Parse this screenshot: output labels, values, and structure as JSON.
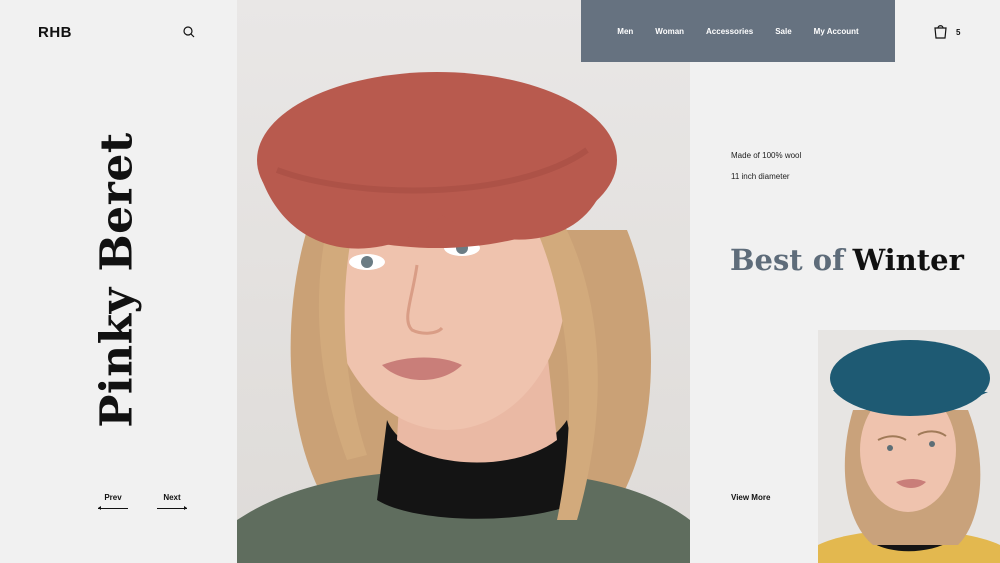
{
  "brand": {
    "logo": "RHB"
  },
  "product": {
    "name": "Pinky Beret"
  },
  "nav": {
    "items": [
      {
        "label": "Men"
      },
      {
        "label": "Woman"
      },
      {
        "label": "Accessories"
      },
      {
        "label": "Sale"
      },
      {
        "label": "My Account"
      }
    ]
  },
  "cart": {
    "count": "5"
  },
  "features": [
    "Made of 100% wool",
    "11 inch diameter"
  ],
  "headline": {
    "part1": "Best of",
    "part2": "Winter"
  },
  "pager": {
    "prev": "Prev",
    "next": "Next"
  },
  "cta": {
    "view_more": "View More"
  },
  "colors": {
    "background": "#f1f1f1",
    "nav_background": "#667280",
    "headline_muted": "#5e6c7a",
    "beret_main": "#b85a4e",
    "beret_thumb": "#1e5a73"
  },
  "icons": {
    "search": "search-icon",
    "cart": "shopping-bag-icon",
    "arrow_left": "arrow-left-icon",
    "arrow_right": "arrow-right-icon"
  }
}
